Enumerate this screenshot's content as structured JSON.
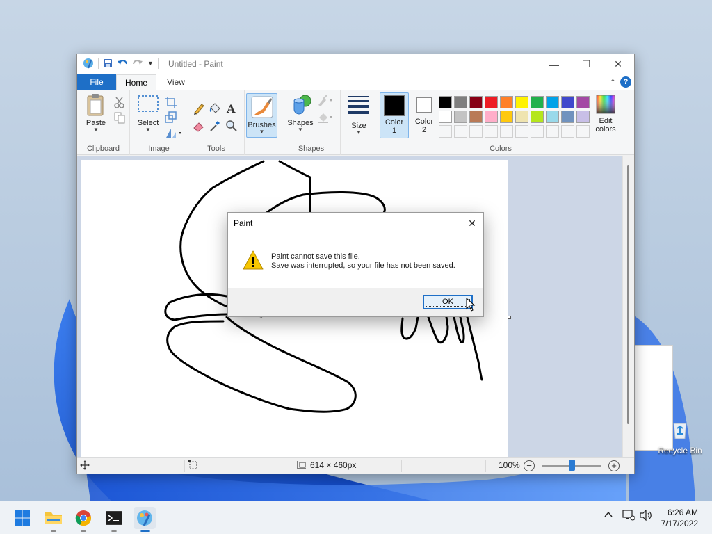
{
  "desktop": {
    "recycle_bin_label": "Recycle Bin"
  },
  "paint": {
    "window_title": "Untitled - Paint",
    "tabs": [
      {
        "label": "File",
        "state": "menu"
      },
      {
        "label": "Home",
        "state": "selected"
      },
      {
        "label": "View",
        "state": "normal"
      }
    ],
    "ribbon": {
      "clipboard": {
        "paste_label": "Paste",
        "group_label": "Clipboard"
      },
      "image": {
        "select_label": "Select",
        "group_label": "Image"
      },
      "tools": {
        "group_label": "Tools"
      },
      "brushes": {
        "label": "Brushes",
        "state": "selected"
      },
      "shapes": {
        "label": "Shapes",
        "group_label": "Shapes"
      },
      "size": {
        "label": "Size"
      },
      "color1": {
        "label_line1": "Color",
        "label_line2": "1",
        "value": "#000000"
      },
      "color2": {
        "label_line1": "Color",
        "label_line2": "2",
        "value": "#ffffff"
      },
      "edit_colors": {
        "label_line1": "Edit",
        "label_line2": "colors"
      },
      "colors_group_label": "Colors",
      "palette_row1": [
        "#000000",
        "#7f7f7f",
        "#880015",
        "#ed1c24",
        "#ff7f27",
        "#fff200",
        "#22b14c",
        "#00a2e8",
        "#3f48cc",
        "#a349a4"
      ],
      "palette_row2": [
        "#ffffff",
        "#c3c3c3",
        "#b97a57",
        "#ffaec9",
        "#ffc90e",
        "#efe4b0",
        "#b5e61d",
        "#99d9ea",
        "#7092be",
        "#c8bfe7"
      ]
    },
    "status": {
      "image_size": "614 × 460px",
      "zoom": "100%",
      "zoom_fraction": 0.5
    }
  },
  "dialog": {
    "title": "Paint",
    "message_line1": "Paint cannot save this file.",
    "message_line2": "Save was interrupted, so your file has not been saved.",
    "ok_label": "OK",
    "icon": "warning-icon"
  },
  "taskbar": {
    "apps": [
      "start",
      "file-explorer",
      "chrome",
      "terminal",
      "paint"
    ],
    "active_app": "paint",
    "time": "6:26 AM",
    "date": "7/17/2022"
  }
}
